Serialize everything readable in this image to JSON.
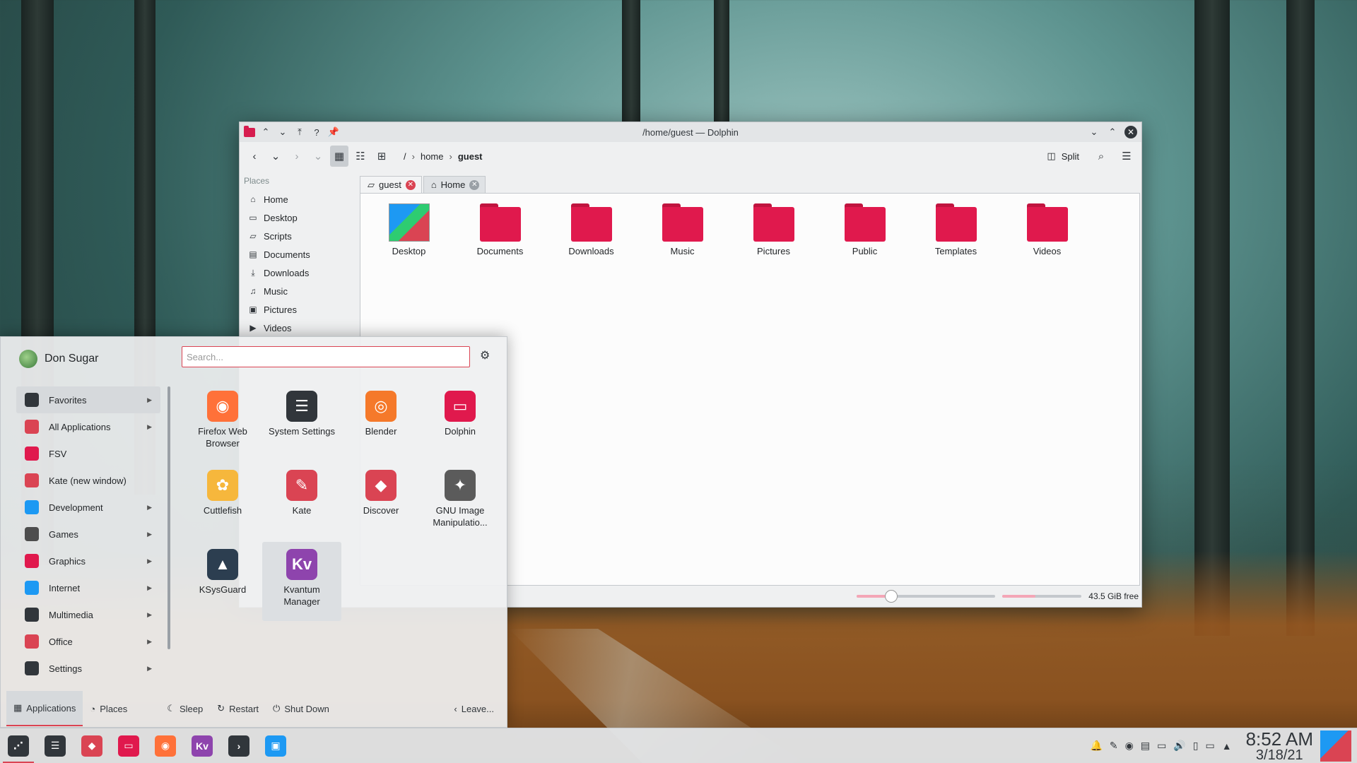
{
  "dolphin": {
    "title": "/home/guest — Dolphin",
    "breadcrumb": {
      "root": "/",
      "segments": [
        "home",
        "guest"
      ]
    },
    "split_label": "Split",
    "places_title": "Places",
    "places": [
      "Home",
      "Desktop",
      "Scripts",
      "Documents",
      "Downloads",
      "Music",
      "Pictures",
      "Videos"
    ],
    "tabs": [
      "guest",
      "Home"
    ],
    "files": [
      "Desktop",
      "Documents",
      "Downloads",
      "Music",
      "Pictures",
      "Public",
      "Templates",
      "Videos"
    ],
    "free_space": "43.5 GiB free",
    "zoom_fraction": 0.25,
    "space_used_fraction": 0.42
  },
  "launcher": {
    "user_name": "Don Sugar",
    "search_placeholder": "Search...",
    "categories": [
      {
        "label": "Favorites",
        "submenu": true,
        "color": "#31363b"
      },
      {
        "label": "All Applications",
        "submenu": true,
        "color": "#da4453"
      },
      {
        "label": "FSV",
        "submenu": false,
        "color": "#e0194d"
      },
      {
        "label": "Kate (new window)",
        "submenu": false,
        "color": "#da4453"
      },
      {
        "label": "Development",
        "submenu": true,
        "color": "#1d99f3"
      },
      {
        "label": "Games",
        "submenu": true,
        "color": "#4d4d4d"
      },
      {
        "label": "Graphics",
        "submenu": true,
        "color": "#e0194d"
      },
      {
        "label": "Internet",
        "submenu": true,
        "color": "#1d99f3"
      },
      {
        "label": "Multimedia",
        "submenu": true,
        "color": "#31363b"
      },
      {
        "label": "Office",
        "submenu": true,
        "color": "#da4453"
      },
      {
        "label": "Settings",
        "submenu": true,
        "color": "#31363b"
      }
    ],
    "apps": [
      {
        "name": "Firefox Web Browser",
        "color": "#ff7139",
        "glyph": "◉"
      },
      {
        "name": "System Settings",
        "color": "#31363b",
        "glyph": "☰"
      },
      {
        "name": "Blender",
        "color": "#f5792a",
        "glyph": "◎"
      },
      {
        "name": "Dolphin",
        "color": "#e0194d",
        "glyph": "▭"
      },
      {
        "name": "Cuttlefish",
        "color": "#f6b73c",
        "glyph": "✿"
      },
      {
        "name": "Kate",
        "color": "#da4453",
        "glyph": "✎"
      },
      {
        "name": "Discover",
        "color": "#da4453",
        "glyph": "◆"
      },
      {
        "name": "GNU Image Manipulatio...",
        "color": "#5b5b5b",
        "glyph": "✦"
      },
      {
        "name": "KSysGuard",
        "color": "#2c3e50",
        "glyph": "▲"
      },
      {
        "name": "Kvantum Manager",
        "color": "#8e44ad",
        "glyph": "Kv"
      }
    ],
    "footer": {
      "applications": "Applications",
      "places": "Places",
      "sleep": "Sleep",
      "restart": "Restart",
      "shutdown": "Shut Down",
      "leave": "Leave..."
    }
  },
  "taskbar": {
    "apps": [
      {
        "name": "launcher",
        "color": "#31363b",
        "glyph": "⋰"
      },
      {
        "name": "system-settings",
        "color": "#31363b",
        "glyph": "☰"
      },
      {
        "name": "discover",
        "color": "#da4453",
        "glyph": "◆"
      },
      {
        "name": "dolphin",
        "color": "#e0194d",
        "glyph": "▭"
      },
      {
        "name": "firefox",
        "color": "#ff7139",
        "glyph": "◉"
      },
      {
        "name": "kvantum",
        "color": "#8e44ad",
        "glyph": "Kv"
      },
      {
        "name": "konsole",
        "color": "#31363b",
        "glyph": "›"
      },
      {
        "name": "screenshot",
        "color": "#1d99f3",
        "glyph": "▣"
      }
    ],
    "time": "8:52 AM",
    "date": "3/18/21"
  }
}
